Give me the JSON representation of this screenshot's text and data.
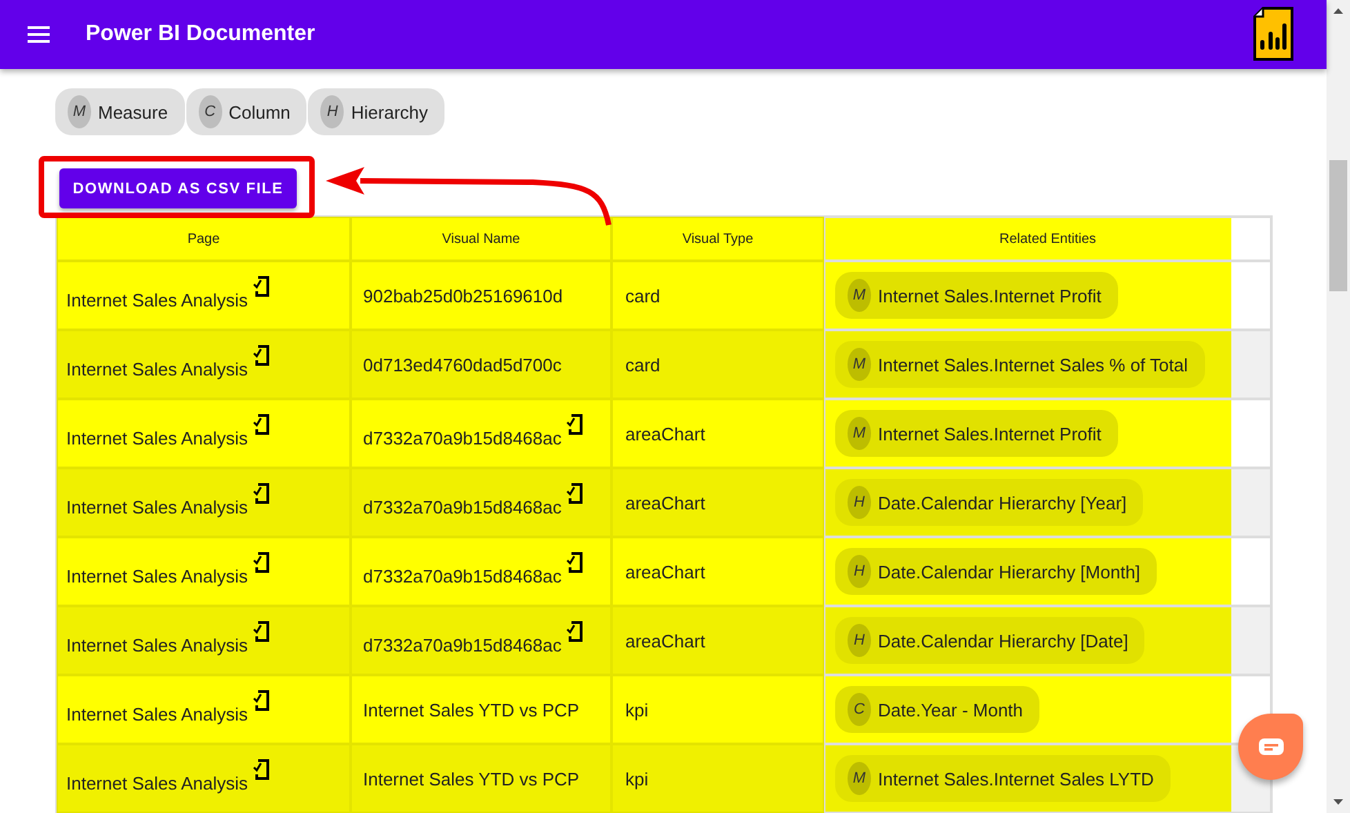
{
  "app_bar": {
    "title": "Power BI Documenter"
  },
  "legend": [
    {
      "badge": "M",
      "label": "Measure"
    },
    {
      "badge": "C",
      "label": "Column"
    },
    {
      "badge": "H",
      "label": "Hierarchy"
    }
  ],
  "download_button": "DOWNLOAD AS CSV FILE",
  "table": {
    "columns": [
      "Page",
      "Visual Name",
      "Visual Type",
      "Related Entities"
    ],
    "rows": [
      {
        "page": "Internet Sales Analysis",
        "page_linked": true,
        "visual_name": "902bab25d0b25169610d",
        "name_linked": false,
        "visual_type": "card",
        "entity": {
          "badge": "M",
          "label": "Internet Sales.Internet Profit"
        }
      },
      {
        "page": "Internet Sales Analysis",
        "page_linked": true,
        "visual_name": "0d713ed4760dad5d700c",
        "name_linked": false,
        "visual_type": "card",
        "entity": {
          "badge": "M",
          "label": "Internet Sales.Internet Sales % of Total"
        }
      },
      {
        "page": "Internet Sales Analysis",
        "page_linked": true,
        "visual_name": "d7332a70a9b15d8468ac",
        "name_linked": true,
        "visual_type": "areaChart",
        "entity": {
          "badge": "M",
          "label": "Internet Sales.Internet Profit"
        }
      },
      {
        "page": "Internet Sales Analysis",
        "page_linked": true,
        "visual_name": "d7332a70a9b15d8468ac",
        "name_linked": true,
        "visual_type": "areaChart",
        "entity": {
          "badge": "H",
          "label": "Date.Calendar Hierarchy [Year]"
        }
      },
      {
        "page": "Internet Sales Analysis",
        "page_linked": true,
        "visual_name": "d7332a70a9b15d8468ac",
        "name_linked": true,
        "visual_type": "areaChart",
        "entity": {
          "badge": "H",
          "label": "Date.Calendar Hierarchy [Month]"
        }
      },
      {
        "page": "Internet Sales Analysis",
        "page_linked": true,
        "visual_name": "d7332a70a9b15d8468ac",
        "name_linked": true,
        "visual_type": "areaChart",
        "entity": {
          "badge": "H",
          "label": "Date.Calendar Hierarchy [Date]"
        }
      },
      {
        "page": "Internet Sales Analysis",
        "page_linked": true,
        "visual_name": "Internet Sales YTD vs PCP",
        "name_linked": false,
        "visual_type": "kpi",
        "entity": {
          "badge": "C",
          "label": "Date.Year - Month"
        }
      },
      {
        "page": "Internet Sales Analysis",
        "page_linked": true,
        "visual_name": "Internet Sales YTD vs PCP",
        "name_linked": false,
        "visual_type": "kpi",
        "entity": {
          "badge": "M",
          "label": "Internet Sales.Internet Sales LYTD"
        }
      }
    ]
  }
}
